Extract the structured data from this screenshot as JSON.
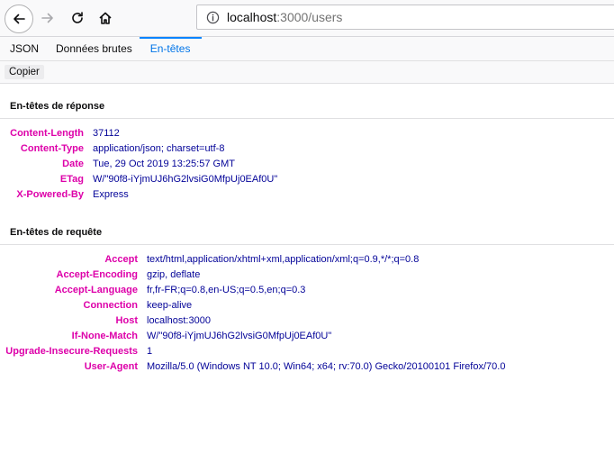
{
  "browser": {
    "url_host": "localhost",
    "url_rest": ":3000/users"
  },
  "tabs": [
    {
      "label": "JSON"
    },
    {
      "label": "Données brutes"
    },
    {
      "label": "En-têtes"
    }
  ],
  "actions": {
    "copy_label": "Copier"
  },
  "response": {
    "title": "En-têtes de réponse",
    "headers": [
      {
        "name": "Content-Length",
        "value": "37112"
      },
      {
        "name": "Content-Type",
        "value": "application/json; charset=utf-8"
      },
      {
        "name": "Date",
        "value": "Tue, 29 Oct 2019 13:25:57 GMT"
      },
      {
        "name": "ETag",
        "value": "W/\"90f8-iYjmUJ6hG2lvsiG0MfpUj0EAf0U\""
      },
      {
        "name": "X-Powered-By",
        "value": "Express"
      }
    ]
  },
  "request": {
    "title": "En-têtes de requête",
    "headers": [
      {
        "name": "Accept",
        "value": "text/html,application/xhtml+xml,application/xml;q=0.9,*/*;q=0.8"
      },
      {
        "name": "Accept-Encoding",
        "value": "gzip, deflate"
      },
      {
        "name": "Accept-Language",
        "value": "fr,fr-FR;q=0.8,en-US;q=0.5,en;q=0.3"
      },
      {
        "name": "Connection",
        "value": "keep-alive"
      },
      {
        "name": "Host",
        "value": "localhost:3000"
      },
      {
        "name": "If-None-Match",
        "value": "W/\"90f8-iYjmUJ6hG2lvsiG0MfpUj0EAf0U\""
      },
      {
        "name": "Upgrade-Insecure-Requests",
        "value": "1"
      },
      {
        "name": "User-Agent",
        "value": "Mozilla/5.0 (Windows NT 10.0; Win64; x64; rv:70.0) Gecko/20100101 Firefox/70.0"
      }
    ]
  }
}
